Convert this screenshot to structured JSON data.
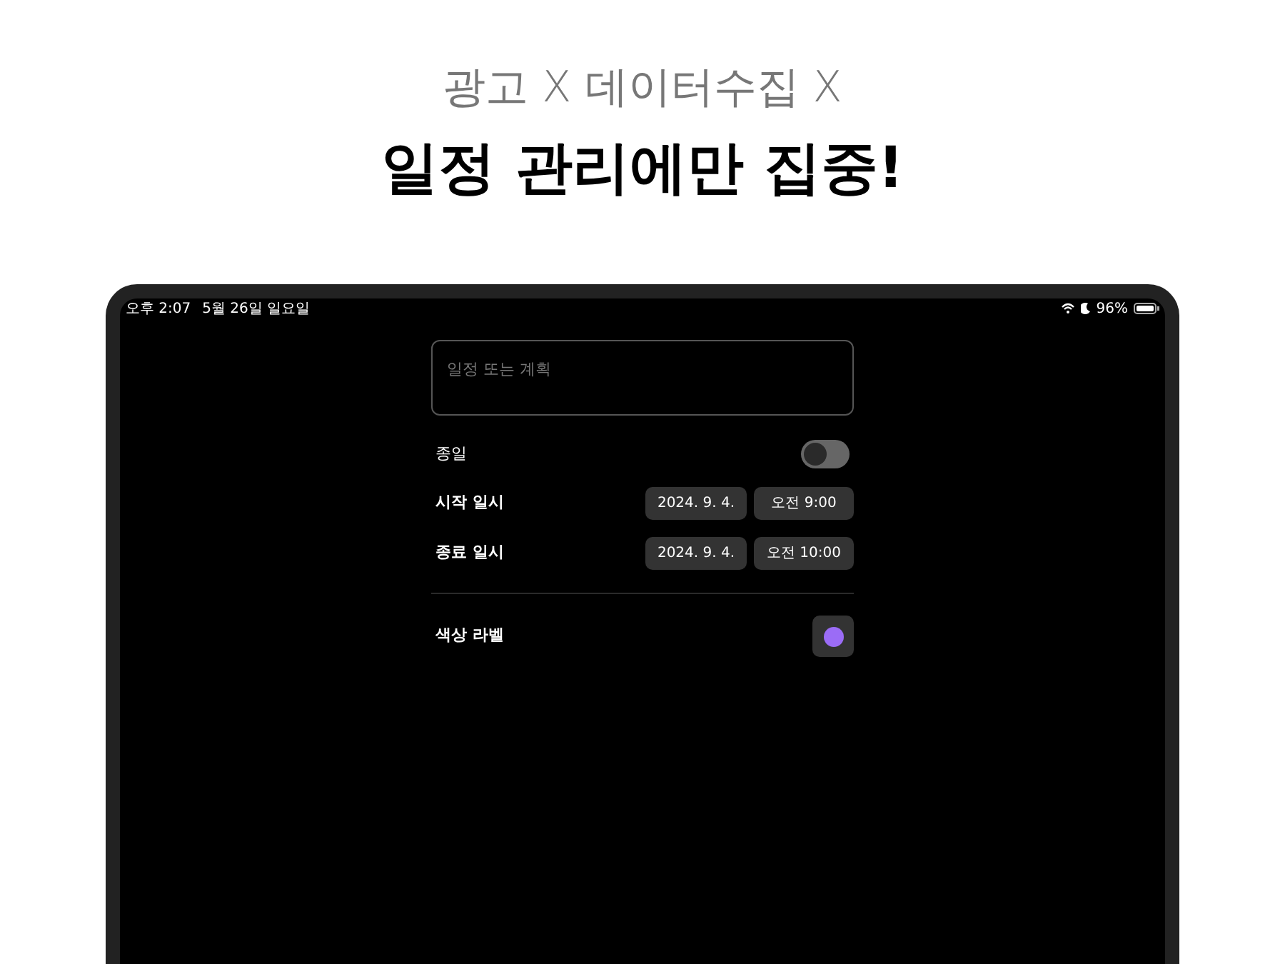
{
  "headline": {
    "subtitle": "광고 X 데이터수집 X",
    "title": "일정 관리에만 집중!"
  },
  "status_bar": {
    "time": "오후 2:07",
    "date": "5월 26일 일요일",
    "battery": "96%"
  },
  "form": {
    "title_field": {
      "placeholder": "일정 또는 계획"
    },
    "all_day": {
      "label": "종일",
      "on": false
    },
    "rows": [
      {
        "label": "시작 일시",
        "date": "2024. 9. 4.",
        "time": "오전 9:00"
      },
      {
        "label": "종료 일시",
        "date": "2024. 9. 4.",
        "time": "오전 10:00"
      }
    ],
    "color_label": {
      "label": "색상 라벨",
      "color": "#9b6cf6"
    }
  }
}
